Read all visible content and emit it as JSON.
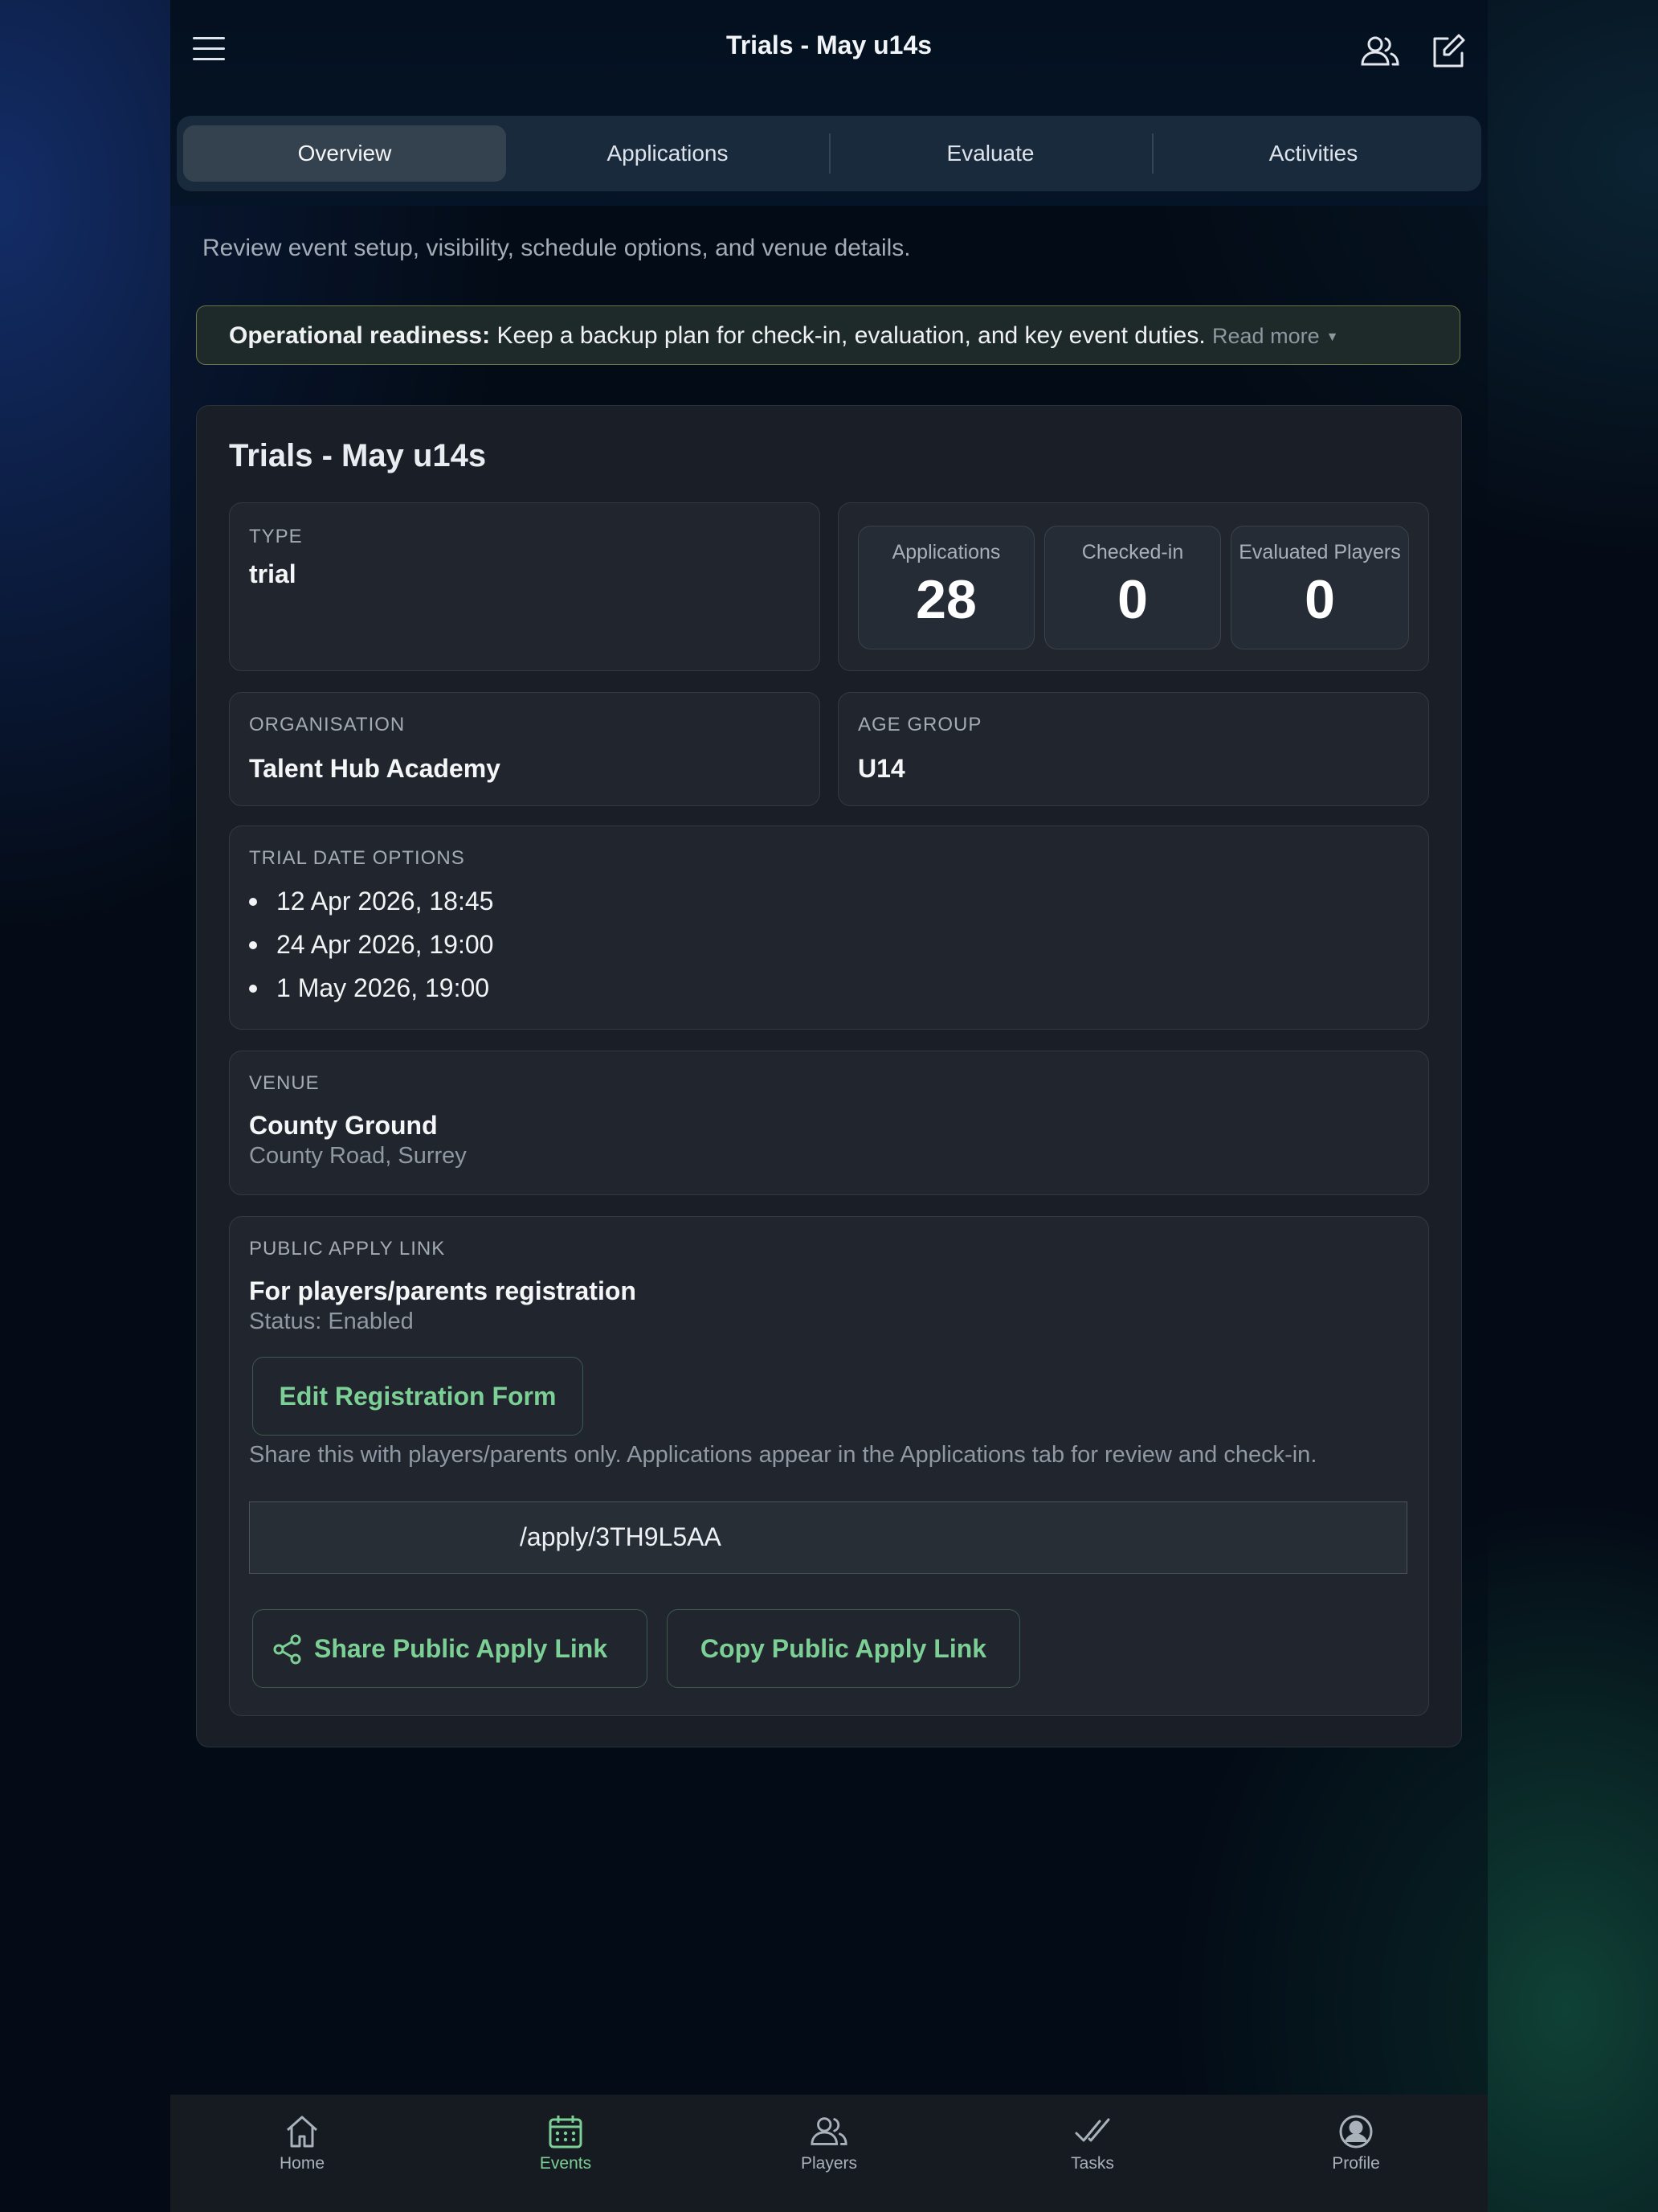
{
  "header": {
    "title": "Trials - May u14s",
    "menu_icon": "hamburger-icon",
    "players_icon": "users-icon",
    "edit_icon": "edit-icon"
  },
  "tabs": [
    {
      "label": "Overview",
      "active": true
    },
    {
      "label": "Applications",
      "active": false
    },
    {
      "label": "Evaluate",
      "active": false
    },
    {
      "label": "Activities",
      "active": false
    }
  ],
  "subtitle": "Review event setup, visibility, schedule options, and venue details.",
  "banner": {
    "bold": "Operational readiness:",
    "text": " Keep a backup plan for check-in, evaluation, and key event duties.",
    "read_more": "Read more",
    "caret": "▼"
  },
  "event": {
    "title": "Trials - May u14s",
    "type_label": "TYPE",
    "type_value": "trial",
    "stats": [
      {
        "label": "Applications",
        "value": "28"
      },
      {
        "label": "Checked-in",
        "value": "0"
      },
      {
        "label": "Evaluated Players",
        "value": "0"
      }
    ],
    "organisation_label": "ORGANISATION",
    "organisation_value": "Talent Hub Academy",
    "age_group_label": "AGE GROUP",
    "age_group_value": "U14",
    "dates_label": "TRIAL DATE OPTIONS",
    "dates": [
      "12 Apr 2026, 18:45",
      "24 Apr 2026, 19:00",
      "1 May 2026, 19:00"
    ],
    "venue_label": "VENUE",
    "venue_name": "County Ground",
    "venue_address": "County Road, Surrey",
    "public_link": {
      "label": "PUBLIC APPLY LINK",
      "heading": "For players/parents registration",
      "status": "Status: Enabled",
      "edit_button": "Edit Registration Form",
      "note": "Share this with players/parents only. Applications appear in the Applications tab for review and check-in.",
      "url": "/apply/3TH9L5AA",
      "share_button": "Share Public Apply Link",
      "copy_button": "Copy Public Apply Link"
    }
  },
  "bottom_nav": [
    {
      "label": "Home",
      "icon": "home-icon",
      "active": false
    },
    {
      "label": "Events",
      "icon": "calendar-icon",
      "active": true
    },
    {
      "label": "Players",
      "icon": "users-icon",
      "active": false
    },
    {
      "label": "Tasks",
      "icon": "double-check-icon",
      "active": false
    },
    {
      "label": "Profile",
      "icon": "profile-icon",
      "active": false
    }
  ],
  "colors": {
    "accent": "#7ccf95",
    "background": "#040b16",
    "card": "#1a1f27"
  }
}
